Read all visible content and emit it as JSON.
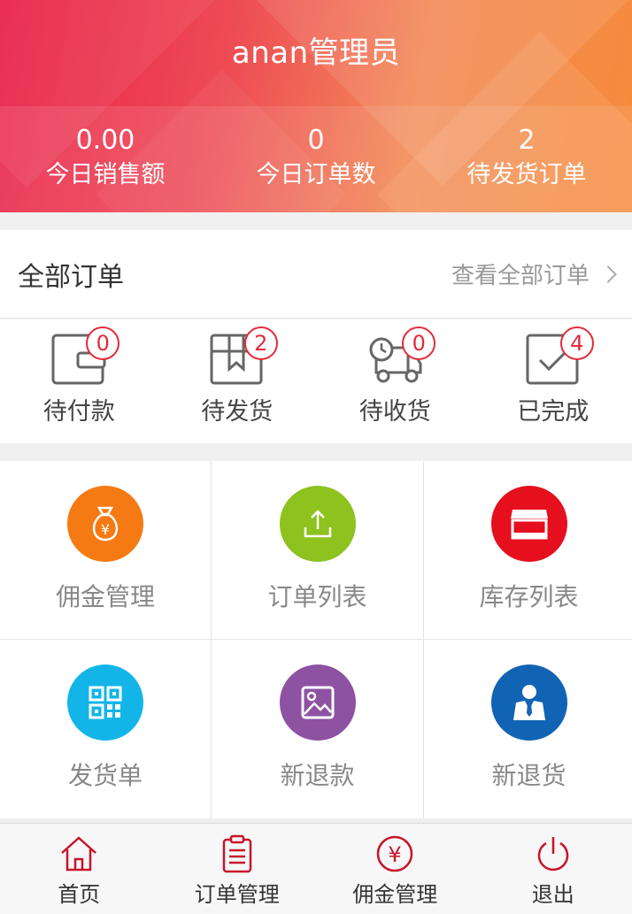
{
  "header": {
    "title": "anan管理员",
    "stats": [
      {
        "value": "0.00",
        "label": "今日销售额"
      },
      {
        "value": "0",
        "label": "今日订单数"
      },
      {
        "value": "2",
        "label": "待发货订单"
      }
    ]
  },
  "orders": {
    "title": "全部订单",
    "view_all": "查看全部订单"
  },
  "order_status": [
    {
      "label": "待付款",
      "count": "0",
      "icon": "wallet-icon"
    },
    {
      "label": "待发货",
      "count": "2",
      "icon": "box-icon"
    },
    {
      "label": "待收货",
      "count": "0",
      "icon": "truck-icon"
    },
    {
      "label": "已完成",
      "count": "4",
      "icon": "check-box-icon"
    }
  ],
  "features": [
    {
      "label": "佣金管理",
      "icon": "money-bag-icon",
      "color": "#f57a14"
    },
    {
      "label": "订单列表",
      "icon": "upload-icon",
      "color": "#8dc21f"
    },
    {
      "label": "库存列表",
      "icon": "store-icon",
      "color": "#e60f1e"
    },
    {
      "label": "发货单",
      "icon": "qr-code-icon",
      "color": "#13b5e9"
    },
    {
      "label": "新退款",
      "icon": "image-icon",
      "color": "#8e52a3"
    },
    {
      "label": "新退货",
      "icon": "person-suit-icon",
      "color": "#1164b4"
    }
  ],
  "tabbar": [
    {
      "label": "首页",
      "icon": "home-icon"
    },
    {
      "label": "订单管理",
      "icon": "clipboard-icon"
    },
    {
      "label": "佣金管理",
      "icon": "yen-icon"
    },
    {
      "label": "退出",
      "icon": "power-icon"
    }
  ],
  "colors": {
    "accent": "#e32b3a",
    "tab_icon": "#c8142b"
  }
}
